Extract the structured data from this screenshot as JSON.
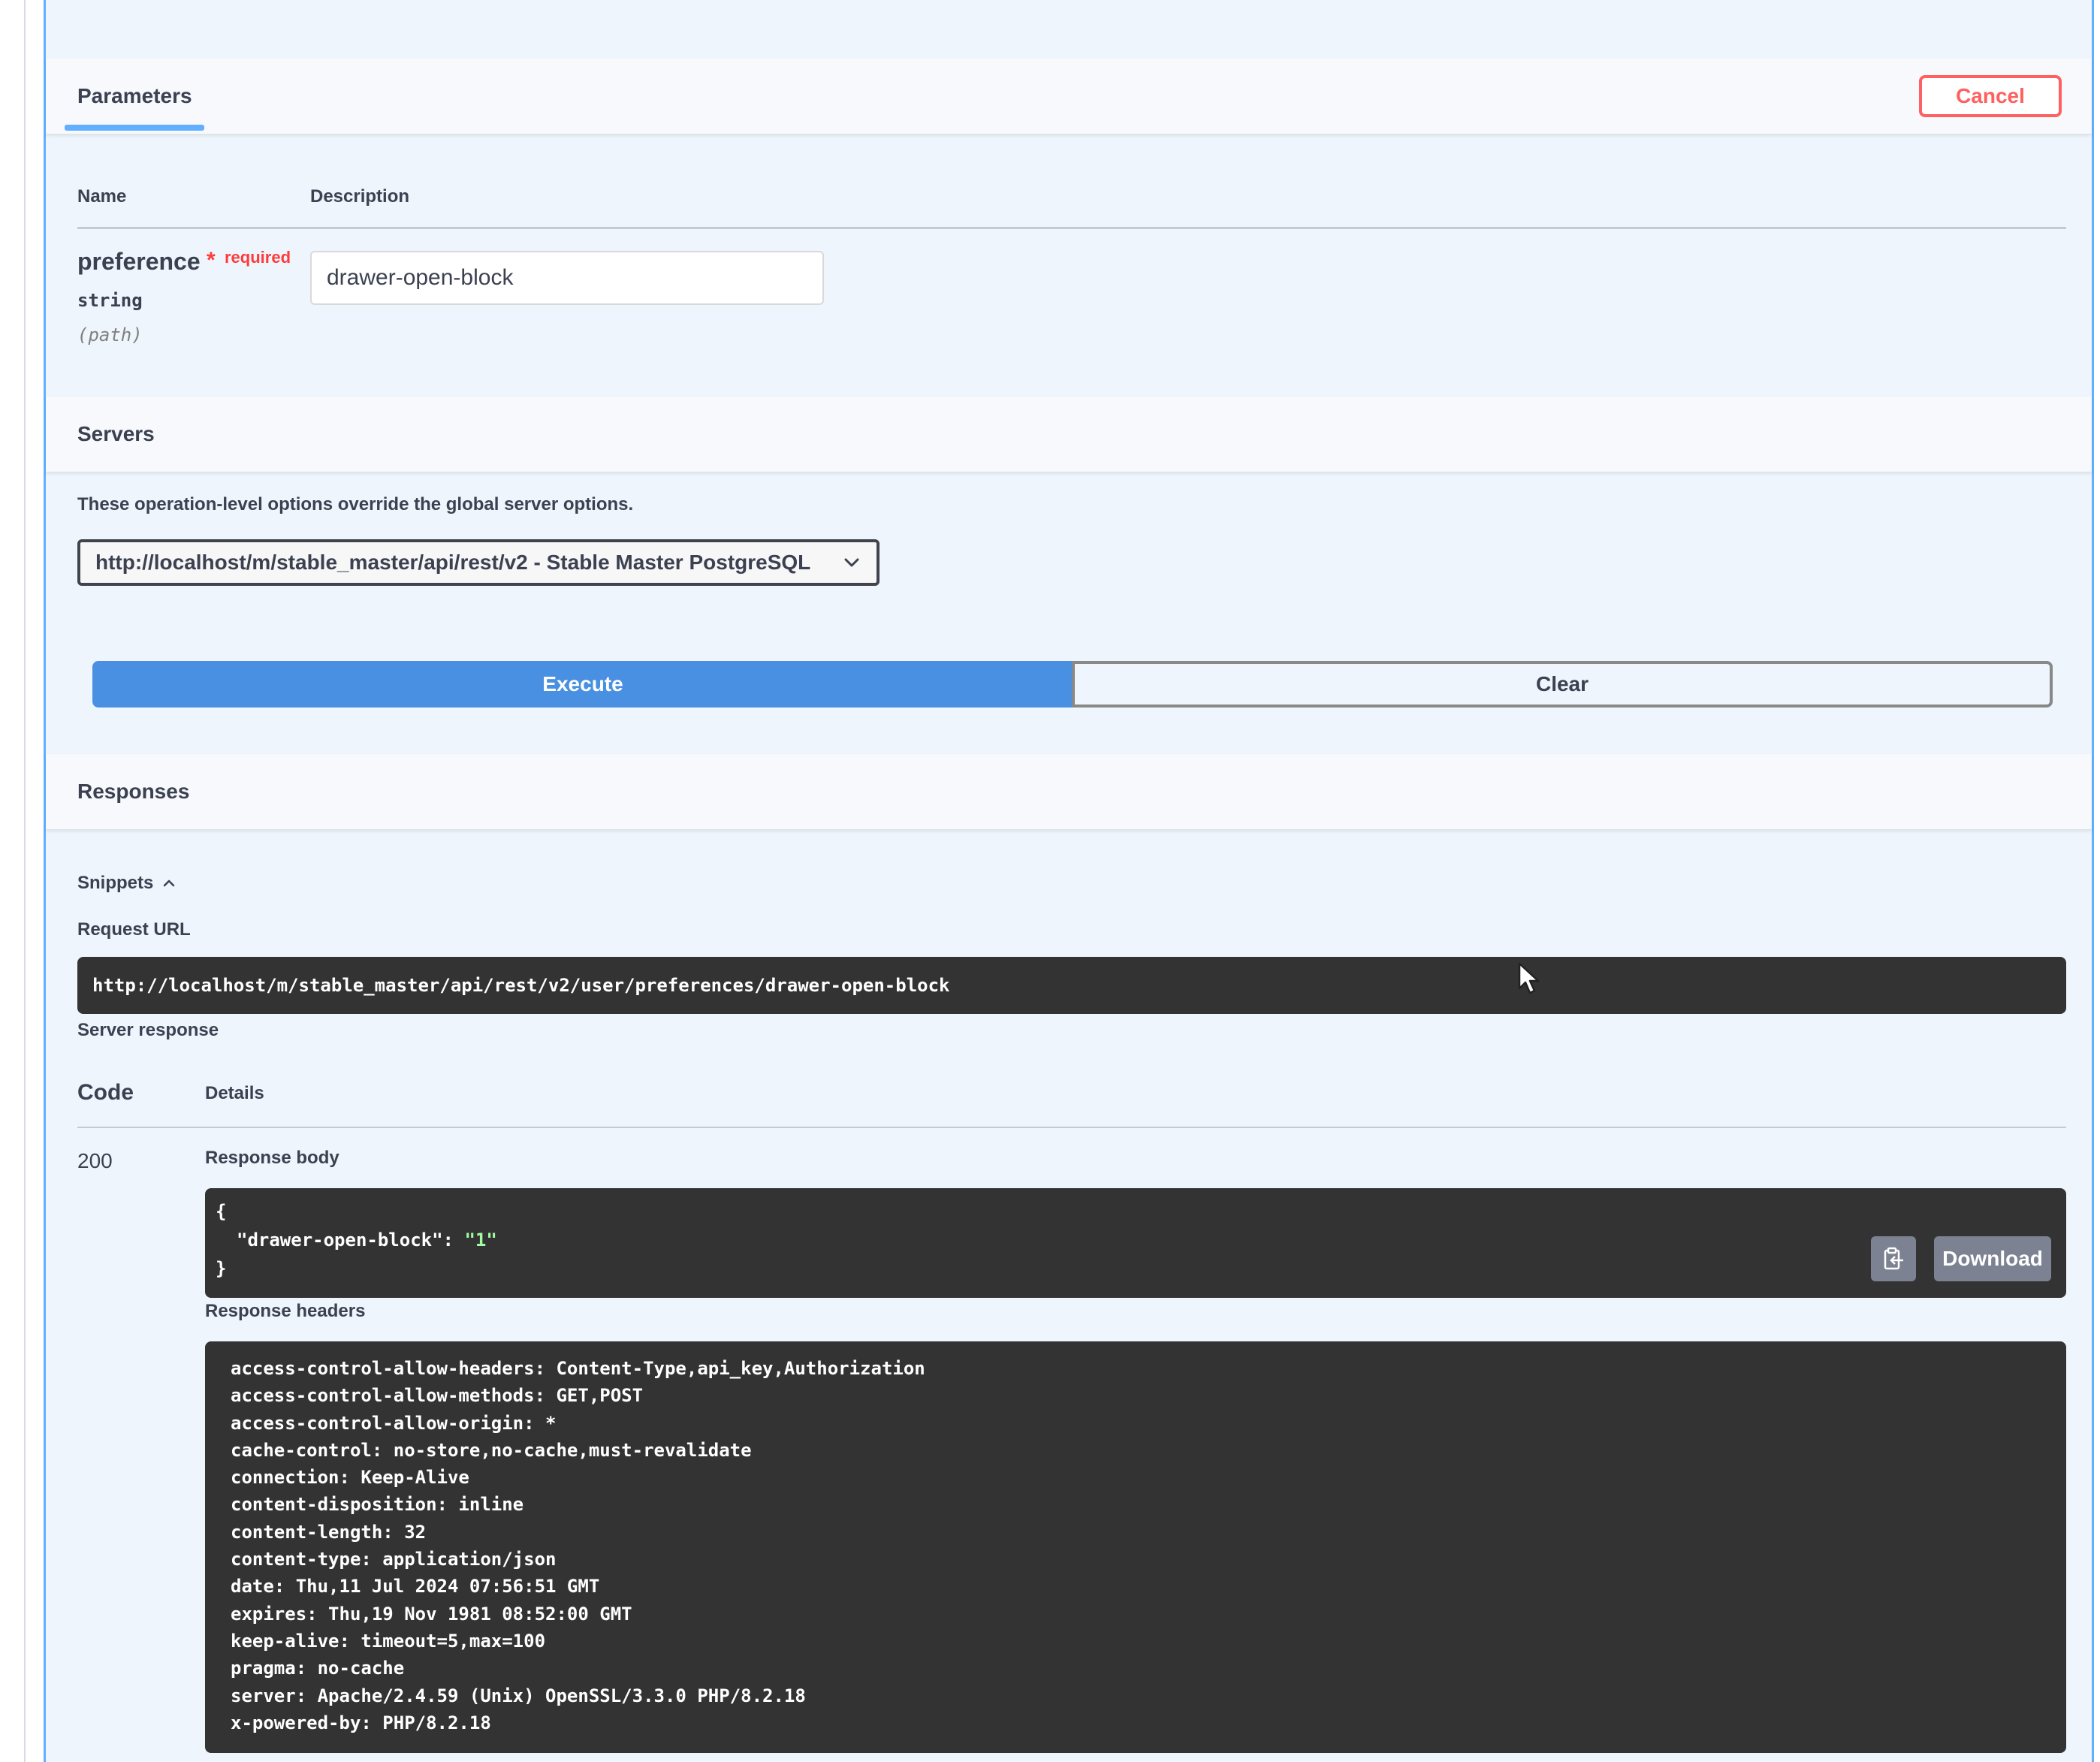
{
  "parameters": {
    "tab_label": "Parameters",
    "cancel_label": "Cancel",
    "columns": {
      "name": "Name",
      "description": "Description"
    },
    "param": {
      "name": "preference",
      "required_star": "*",
      "required_label": "required",
      "type": "string",
      "in": "(path)",
      "value": "drawer-open-block"
    }
  },
  "servers": {
    "title": "Servers",
    "note": "These operation-level options override the global server options.",
    "selected": "http://localhost/m/stable_master/api/rest/v2 - Stable Master PostgreSQL"
  },
  "actions": {
    "execute_label": "Execute",
    "clear_label": "Clear"
  },
  "responses": {
    "title": "Responses",
    "snippets_label": "Snippets",
    "request_url_label": "Request URL",
    "request_url": "http://localhost/m/stable_master/api/rest/v2/user/preferences/drawer-open-block",
    "server_response_label": "Server response",
    "code_header": "Code",
    "details_header": "Details",
    "status_code": "200",
    "body_label": "Response body",
    "body": {
      "open": "{",
      "key": "\"drawer-open-block\"",
      "sep": ": ",
      "value": "\"1\"",
      "close": "}"
    },
    "download_label": "Download",
    "headers_label": "Response headers",
    "headers": [
      "access-control-allow-headers: Content-Type,api_key,Authorization",
      "access-control-allow-methods: GET,POST",
      "access-control-allow-origin: *",
      "cache-control: no-store,no-cache,must-revalidate",
      "connection: Keep-Alive",
      "content-disposition: inline",
      "content-length: 32",
      "content-type: application/json",
      "date: Thu,11 Jul 2024 07:56:51 GMT",
      "expires: Thu,19 Nov 1981 08:52:00 GMT",
      "keep-alive: timeout=5,max=100",
      "pragma: no-cache",
      "server: Apache/2.4.59 (Unix) OpenSSL/3.3.0 PHP/8.2.18",
      "x-powered-by: PHP/8.2.18"
    ]
  },
  "colors": {
    "accent_blue": "#61affe",
    "execute_blue": "#4990e2",
    "cancel_red": "#ff6060",
    "code_bg": "#333333",
    "json_string": "#a2fca2"
  }
}
